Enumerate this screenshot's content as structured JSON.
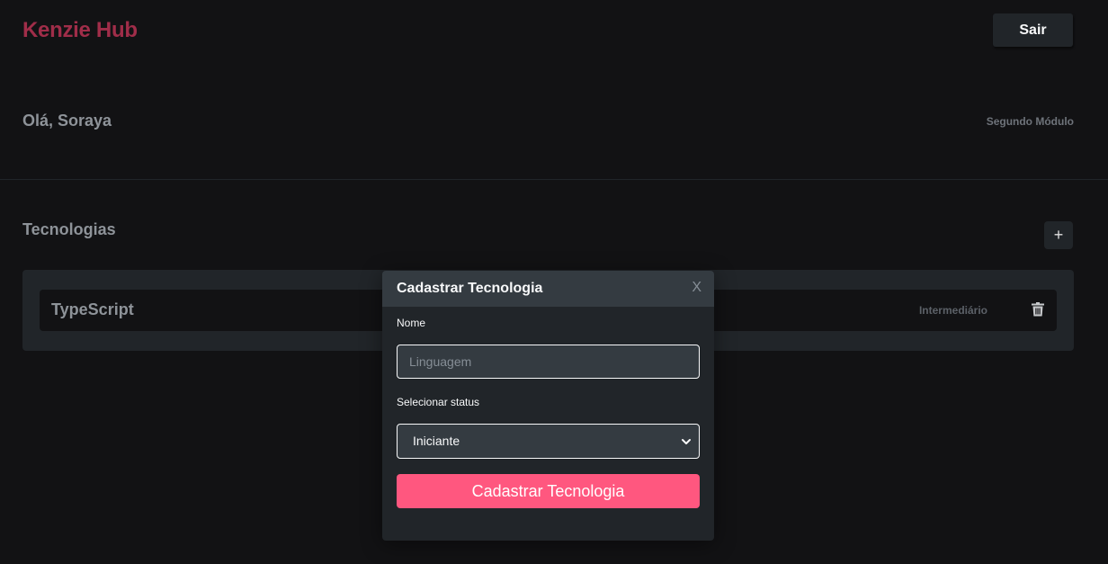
{
  "header": {
    "logo": "Kenzie Hub",
    "logout_label": "Sair"
  },
  "profile": {
    "greeting": "Olá, Soraya",
    "module": "Segundo Módulo"
  },
  "technologies": {
    "title": "Tecnologias",
    "add_label": "+",
    "items": [
      {
        "name": "TypeScript",
        "status": "Intermediário",
        "icon": "trash-icon"
      }
    ]
  },
  "modal": {
    "title": "Cadastrar Tecnologia",
    "close_label": "X",
    "name_label": "Nome",
    "name_placeholder": "Linguagem",
    "name_value": "",
    "status_label": "Selecionar status",
    "status_selected": "Iniciante",
    "submit_label": "Cadastrar Tecnologia"
  },
  "colors": {
    "background": "#121214",
    "brand": "#a02d49",
    "primary": "#ff577f",
    "surface": "#212529",
    "surface_light": "#343b41"
  }
}
